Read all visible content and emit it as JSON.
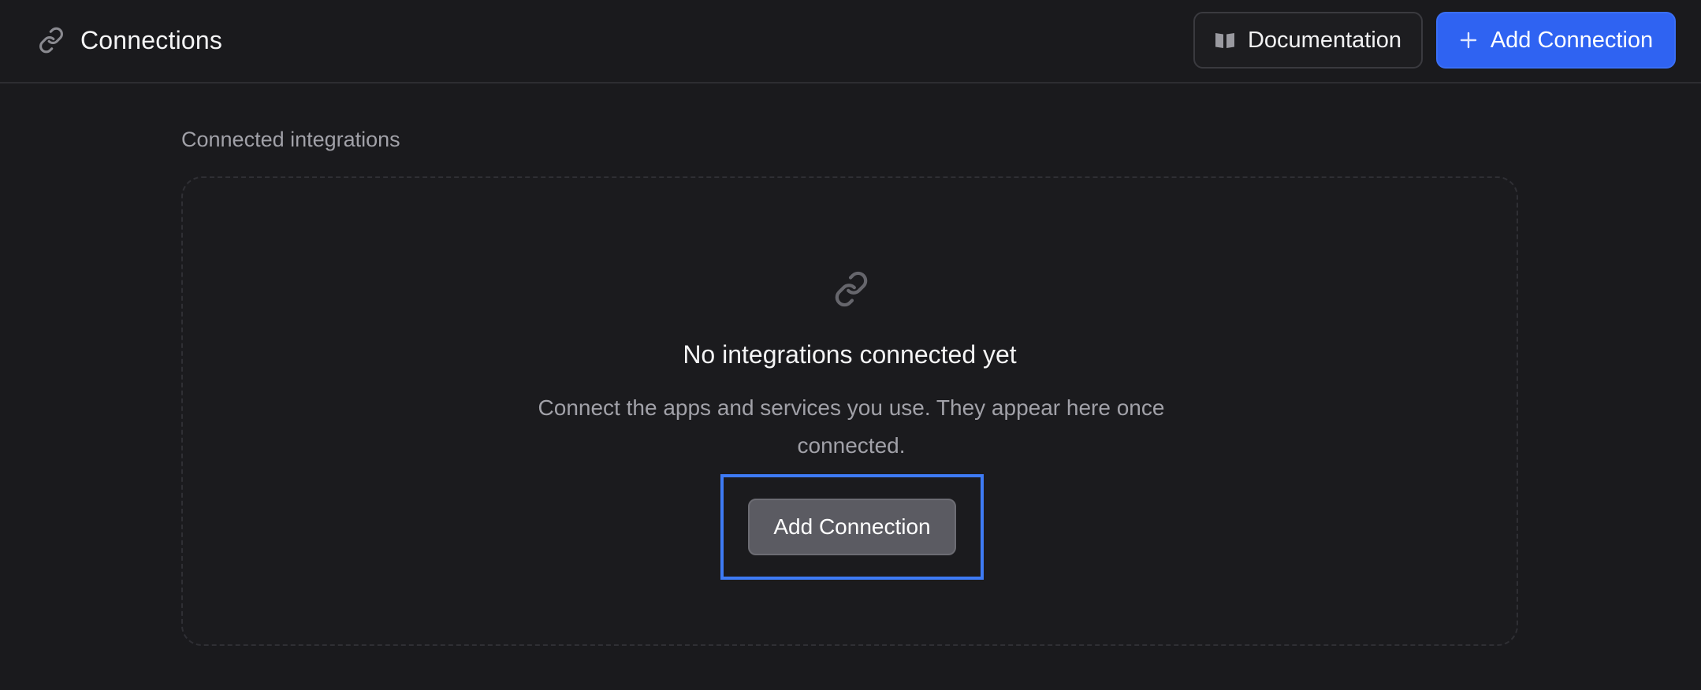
{
  "header": {
    "title": "Connections",
    "icon": "link-icon",
    "documentation_label": "Documentation",
    "documentation_icon": "book-icon",
    "add_connection_label": "Add Connection",
    "add_connection_icon": "plus-icon"
  },
  "main": {
    "section_label": "Connected integrations",
    "empty_state": {
      "icon": "link-icon",
      "title": "No integrations connected yet",
      "description": "Connect the apps and services you use. They appear here once connected.",
      "button_label": "Add Connection"
    }
  },
  "colors": {
    "background": "#1a1a1d",
    "accent": "#2f63f2",
    "focus_ring": "#3e7bf5",
    "muted_text": "#a1a1a8"
  }
}
